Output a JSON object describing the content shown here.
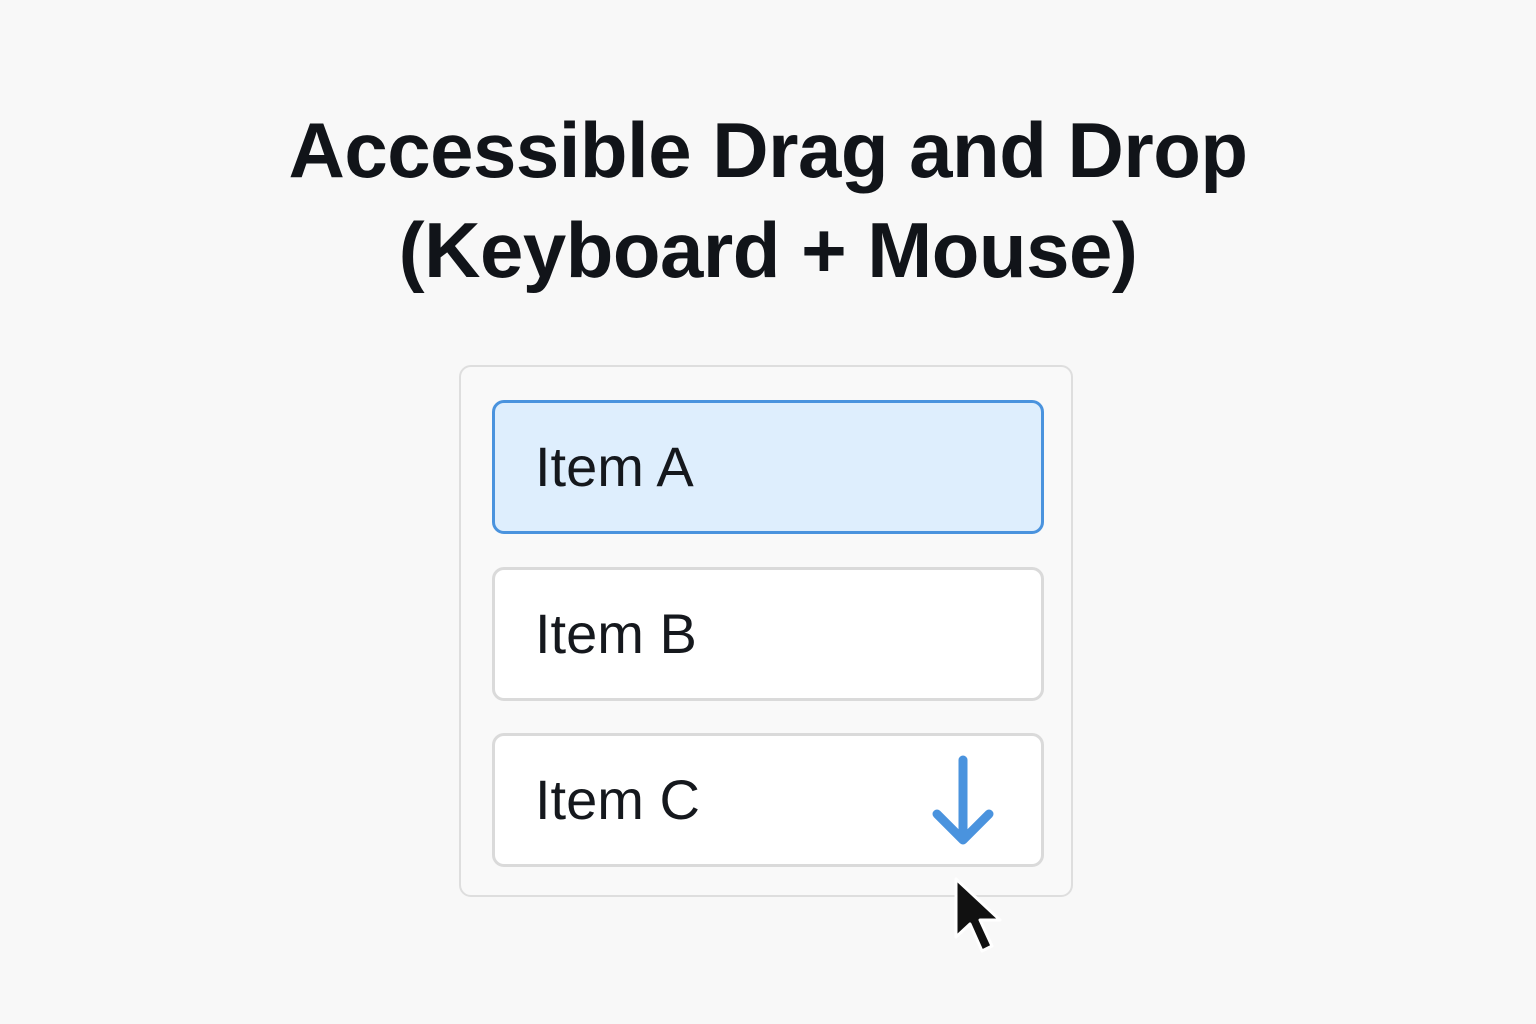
{
  "page": {
    "title_line1": "Accessible Drag and Drop",
    "title_line2": "(Keyboard + Mouse)"
  },
  "list": {
    "items": [
      {
        "label": "Item A",
        "selected": true
      },
      {
        "label": "Item B",
        "selected": false
      },
      {
        "label": "Item C",
        "selected": false,
        "icon": "down-arrow-icon"
      }
    ]
  },
  "pointer": {
    "icon": "cursor-icon"
  },
  "colors": {
    "background": "#f8f8f8",
    "text": "#111419",
    "accent": "#4a93de",
    "selected_fill": "#deeefd",
    "item_border": "#dadada"
  }
}
